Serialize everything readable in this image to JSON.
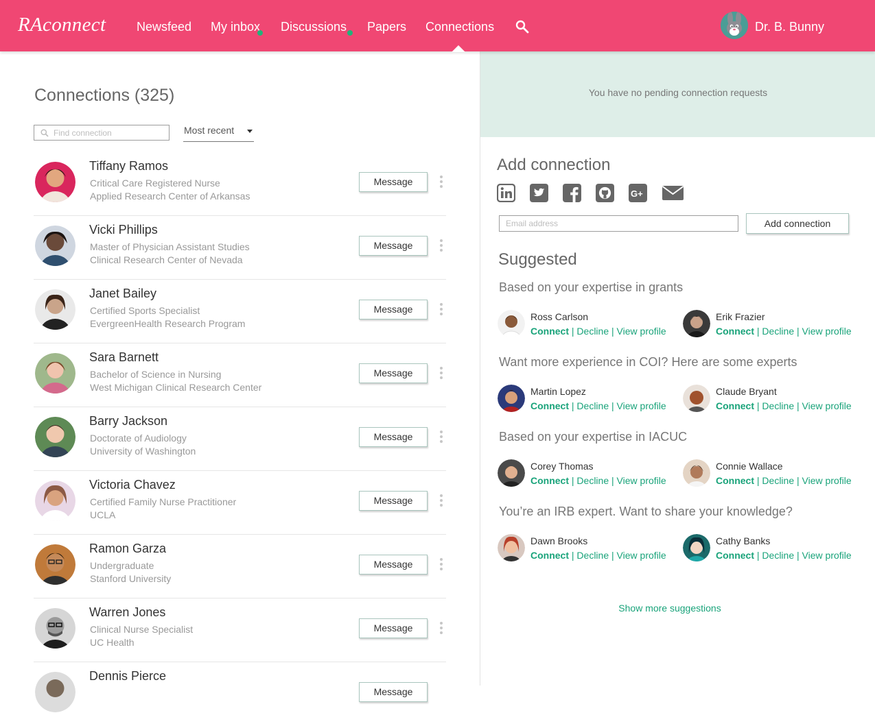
{
  "app": {
    "logo": "RAconnect",
    "nav": [
      {
        "label": "Newsfeed",
        "dot": false
      },
      {
        "label": "My inbox",
        "dot": true
      },
      {
        "label": "Discussions",
        "dot": true
      },
      {
        "label": "Papers",
        "dot": false
      },
      {
        "label": "Connections",
        "dot": false,
        "active": true
      }
    ],
    "user": {
      "name": "Dr. B. Bunny",
      "avatar_icon": "bunny-avatar"
    }
  },
  "connections": {
    "title": "Connections (325)",
    "search_placeholder": "Find connection",
    "sort_value": "Most recent",
    "message_label": "Message",
    "items": [
      {
        "name": "Tiffany Ramos",
        "title": "Critical Care Registered Nurse",
        "org": "Applied Research Center of Arkansas",
        "avatar_color": "#d9265d"
      },
      {
        "name": "Vicki Phillips",
        "title": "Master of Physician Assistant Studies",
        "org": "Clinical Research Center of Nevada",
        "avatar_color": "#6a4a3a"
      },
      {
        "name": "Janet Bailey",
        "title": "Certified Sports Specialist",
        "org": "EvergreenHealth Research Program",
        "avatar_color": "#c9a48a"
      },
      {
        "name": "Sara Barnett",
        "title": "Bachelor of Science in Nursing",
        "org": "West Michigan Clinical Research Center",
        "avatar_color": "#d46a8c"
      },
      {
        "name": "Barry Jackson",
        "title": "Doctorate of Audiology",
        "org": "University of Washington",
        "avatar_color": "#5e8a55"
      },
      {
        "name": "Victoria Chavez",
        "title": "Certified Family Nurse Practitioner",
        "org": "UCLA",
        "avatar_color": "#8c5a45"
      },
      {
        "name": "Ramon Garza",
        "title": "Undergraduate",
        "org": "Stanford University",
        "avatar_color": "#c07a3a"
      },
      {
        "name": "Warren Jones",
        "title": "Clinical Nurse Specialist",
        "org": "UC Health",
        "avatar_color": "#555555"
      },
      {
        "name": "Dennis Pierce",
        "title": "",
        "org": "",
        "avatar_color": "#7a6a5a"
      }
    ]
  },
  "pending": {
    "text": "You have no pending connection requests"
  },
  "add_connection": {
    "title": "Add connection",
    "social_icons": [
      "linkedin-icon",
      "twitter-icon",
      "facebook-icon",
      "github-icon",
      "google-plus-icon",
      "email-icon"
    ],
    "email_placeholder": "Email address",
    "button_label": "Add connection"
  },
  "suggested": {
    "title": "Suggested",
    "connect_label": "Connect",
    "decline_label": "Decline",
    "view_label": "View profile",
    "separator": "|",
    "groups": [
      {
        "heading": "Based on your expertise in grants",
        "people": [
          {
            "name": "Ross Carlson",
            "avatar_color": "#8a5a3a"
          },
          {
            "name": "Erik Frazier",
            "avatar_color": "#3a3a3a"
          }
        ]
      },
      {
        "heading": "Want more experience in COI? Here are some experts",
        "people": [
          {
            "name": "Martin Lopez",
            "avatar_color": "#2b3a7a"
          },
          {
            "name": "Claude Bryant",
            "avatar_color": "#a0522d"
          }
        ]
      },
      {
        "heading": "Based on your expertise in IACUC",
        "people": [
          {
            "name": "Corey Thomas",
            "avatar_color": "#4a4a4a"
          },
          {
            "name": "Connie Wallace",
            "avatar_color": "#b07a5a"
          }
        ]
      },
      {
        "heading": "You’re an IRB expert. Want to share your knowledge?",
        "people": [
          {
            "name": "Dawn Brooks",
            "avatar_color": "#b8402a"
          },
          {
            "name": "Cathy Banks",
            "avatar_color": "#1b6a6a"
          }
        ]
      }
    ],
    "show_more": "Show more suggestions"
  },
  "colors": {
    "brand": "#f04773",
    "accent_green": "#19a37a",
    "pending_bg": "#deeee8",
    "notification_dot": "#21b27a"
  }
}
